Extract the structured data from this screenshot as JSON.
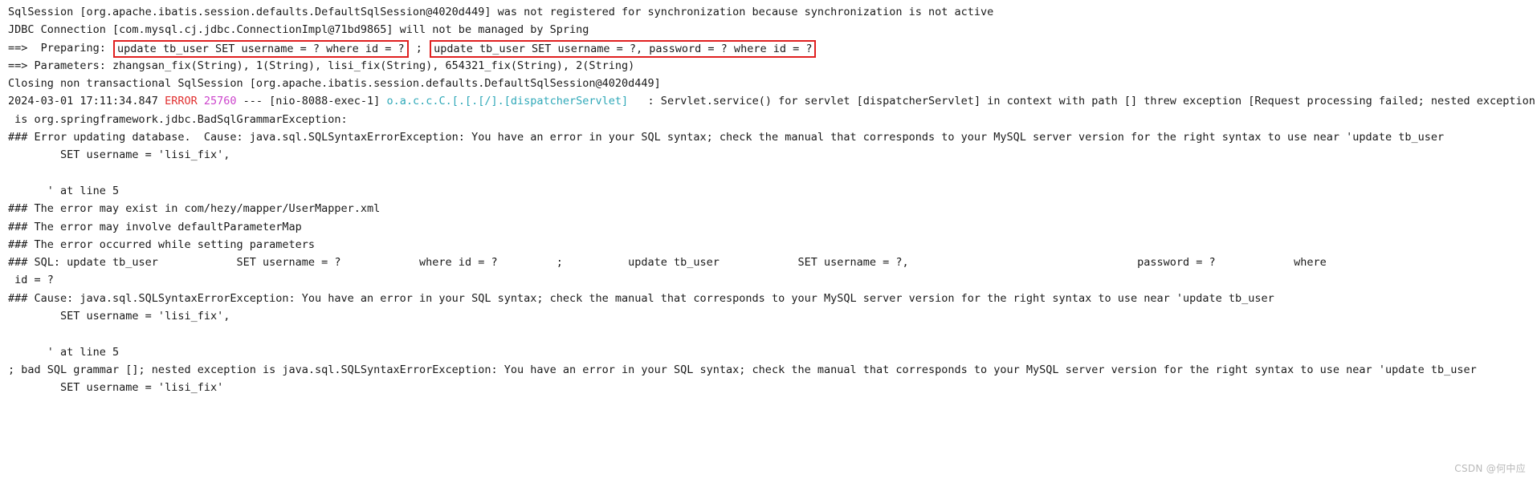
{
  "window": {
    "kind": "console-log-output",
    "background_color": "#ffffff",
    "text_color": "#1a1a1a"
  },
  "colors": {
    "plain": "#1a1a1a",
    "error_level": "#e03030",
    "process_id": "#cc44cc",
    "logger_name": "#2fa8b8",
    "highlight_border": "#e02020",
    "watermark": "#b9b9b9"
  },
  "highlights": [
    {
      "id": "sql-stmt-1",
      "text": "update tb_user SET username = ? where id = ?",
      "border_color": "#e02020"
    },
    {
      "id": "sql-stmt-2",
      "text": "update tb_user SET username = ?, password = ? where id = ?",
      "border_color": "#e02020"
    }
  ],
  "log": {
    "lines": [
      {
        "id": "line-1",
        "name": "sqlsession-not-registered",
        "segments": [
          {
            "text": "SqlSession [org.apache.ibatis.session.defaults.DefaultSqlSession@4020d449] was not registered for synchronization because synchronization is not active",
            "style": "plain"
          }
        ]
      },
      {
        "id": "line-2",
        "name": "jdbc-connection-not-managed",
        "segments": [
          {
            "text": "JDBC Connection [com.mysql.cj.jdbc.ConnectionImpl@71bd9865] will not be managed by Spring",
            "style": "plain"
          }
        ]
      },
      {
        "id": "line-3",
        "name": "preparing-statement",
        "segments": [
          {
            "text": "==>  Preparing: ",
            "style": "plain"
          },
          {
            "text": "update tb_user SET username = ? where id = ?",
            "style": "plain",
            "box": true
          },
          {
            "text": " ; ",
            "style": "plain"
          },
          {
            "text": "update tb_user SET username = ?, password = ? where id = ?",
            "style": "plain",
            "box": true
          }
        ]
      },
      {
        "id": "line-4",
        "name": "parameters",
        "segments": [
          {
            "text": "==> Parameters: zhangsan_fix(String), 1(String), lisi_fix(String), 654321_fix(String), 2(String)",
            "style": "plain"
          }
        ]
      },
      {
        "id": "line-5",
        "name": "closing-sqlsession",
        "segments": [
          {
            "text": "Closing non transactional SqlSession [org.apache.ibatis.session.defaults.DefaultSqlSession@4020d449]",
            "style": "plain"
          }
        ]
      },
      {
        "id": "line-6",
        "name": "error-entry",
        "segments": [
          {
            "text": "2024-03-01 17:11:34.847 ",
            "style": "plain"
          },
          {
            "text": "ERROR",
            "style": "error"
          },
          {
            "text": " ",
            "style": "plain"
          },
          {
            "text": "25760",
            "style": "pid"
          },
          {
            "text": " --- [nio-8088-exec-1] ",
            "style": "plain"
          },
          {
            "text": "o.a.c.c.C.[.[.[/].[dispatcherServlet]",
            "style": "logger"
          },
          {
            "text": "   : Servlet.service() for servlet [dispatcherServlet] in context with path [] threw exception [Request processing failed; nested exception",
            "style": "plain"
          }
        ]
      },
      {
        "id": "line-7",
        "name": "exception-continuation",
        "segments": [
          {
            "text": " is org.springframework.jdbc.BadSqlGrammarException:",
            "style": "plain"
          }
        ]
      },
      {
        "id": "line-8",
        "name": "error-updating-database",
        "segments": [
          {
            "text": "### Error updating database.  Cause: java.sql.SQLSyntaxErrorException: You have an error in your SQL syntax; check the manual that corresponds to your MySQL server version for the right syntax to use near 'update tb_user",
            "style": "plain"
          }
        ]
      },
      {
        "id": "line-9",
        "name": "set-username-fragment-1",
        "segments": [
          {
            "text": "        SET username = 'lisi_fix',",
            "style": "plain"
          }
        ]
      },
      {
        "id": "line-10",
        "name": "blank-1",
        "segments": [
          {
            "text": "",
            "style": "plain"
          }
        ]
      },
      {
        "id": "line-11",
        "name": "at-line-5-fragment-1",
        "segments": [
          {
            "text": "      ' at line 5",
            "style": "plain"
          }
        ]
      },
      {
        "id": "line-12",
        "name": "error-may-exist-in",
        "segments": [
          {
            "text": "### The error may exist in com/hezy/mapper/UserMapper.xml",
            "style": "plain"
          }
        ]
      },
      {
        "id": "line-13",
        "name": "error-may-involve",
        "segments": [
          {
            "text": "### The error may involve defaultParameterMap",
            "style": "plain"
          }
        ]
      },
      {
        "id": "line-14",
        "name": "error-occurred-while",
        "segments": [
          {
            "text": "### The error occurred while setting parameters",
            "style": "plain"
          }
        ]
      },
      {
        "id": "line-15",
        "name": "sql-statement-echo",
        "segments": [
          {
            "text": "### SQL: update tb_user            SET username = ?            where id = ?         ;          update tb_user            SET username = ?,                                   password = ?            where",
            "style": "plain"
          }
        ]
      },
      {
        "id": "line-16",
        "name": "sql-statement-echo-wrap",
        "segments": [
          {
            "text": " id = ?",
            "style": "plain"
          }
        ]
      },
      {
        "id": "line-17",
        "name": "cause-syntax-error",
        "segments": [
          {
            "text": "### Cause: java.sql.SQLSyntaxErrorException: You have an error in your SQL syntax; check the manual that corresponds to your MySQL server version for the right syntax to use near 'update tb_user",
            "style": "plain"
          }
        ]
      },
      {
        "id": "line-18",
        "name": "set-username-fragment-2",
        "segments": [
          {
            "text": "        SET username = 'lisi_fix',",
            "style": "plain"
          }
        ]
      },
      {
        "id": "line-19",
        "name": "blank-2",
        "segments": [
          {
            "text": "",
            "style": "plain"
          }
        ]
      },
      {
        "id": "line-20",
        "name": "at-line-5-fragment-2",
        "segments": [
          {
            "text": "      ' at line 5",
            "style": "plain"
          }
        ]
      },
      {
        "id": "line-21",
        "name": "bad-sql-grammar",
        "segments": [
          {
            "text": "; bad SQL grammar []; nested exception is java.sql.SQLSyntaxErrorException: You have an error in your SQL syntax; check the manual that corresponds to your MySQL server version for the right syntax to use near 'update tb_user",
            "style": "plain"
          }
        ]
      },
      {
        "id": "line-22",
        "name": "set-username-fragment-3",
        "segments": [
          {
            "text": "        SET username = 'lisi_fix'",
            "style": "plain"
          }
        ]
      }
    ]
  },
  "watermark": {
    "text": "CSDN @何中应"
  }
}
